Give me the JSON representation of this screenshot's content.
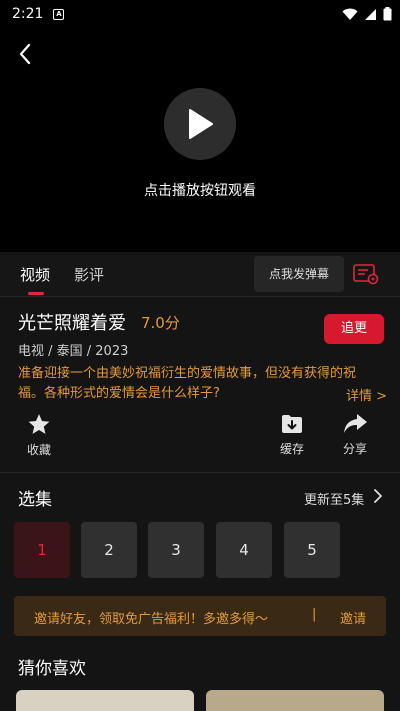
{
  "status_bar": {
    "time": "2:21",
    "notif_glyph": "A",
    "icons": [
      "wifi-icon",
      "signal-icon",
      "battery-icon"
    ]
  },
  "player": {
    "hint": "点击播放按钮观看"
  },
  "tabs": {
    "video": "视频",
    "review": "影评",
    "danmu_button": "点我发弹幕"
  },
  "show": {
    "title": "光芒照耀着爱",
    "score": "7.0分",
    "follow_label": "追更",
    "meta": "电视 / 泰国 / 2023",
    "description": "准备迎接一个由美妙祝福衍生的爱情故事，但没有获得的祝福。各种形式的爱情会是什么样子?",
    "detail_link": "详情 >"
  },
  "actions": {
    "favorite": "收藏",
    "cache": "缓存",
    "share": "分享"
  },
  "episodes": {
    "heading": "选集",
    "update_info": "更新至5集",
    "items": [
      "1",
      "2",
      "3",
      "4",
      "5"
    ],
    "active_index": 0
  },
  "invite": {
    "text": "邀请好友，领取免广告福利！多邀多得～",
    "separator": "|",
    "button": "邀请"
  },
  "recommend": {
    "heading": "猜你喜欢"
  },
  "colors": {
    "accent_red": "#d7192d",
    "accent_orange": "#e39a3c",
    "background": "#141414"
  }
}
